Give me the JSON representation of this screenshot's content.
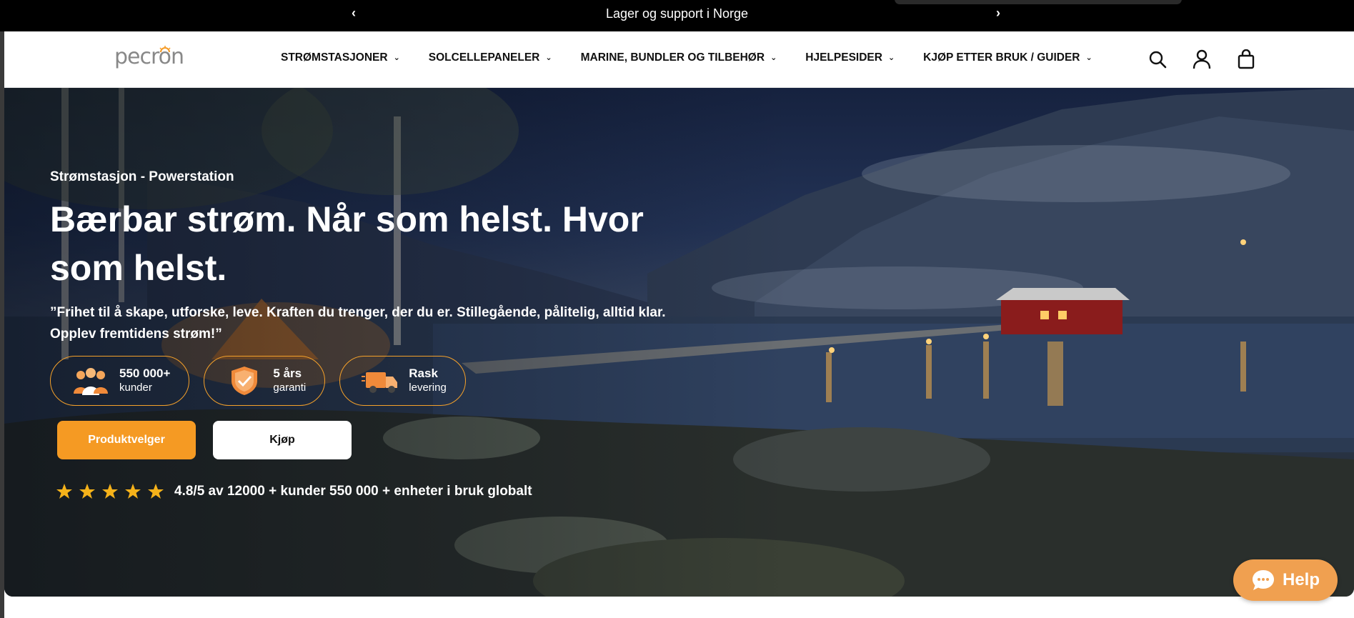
{
  "announcement": {
    "message": "Lager og support i Norge",
    "prev_icon": "chevron-left-icon",
    "next_icon": "chevron-right-icon"
  },
  "header": {
    "logo_text": "pecron",
    "nav": [
      {
        "label": "STRØMSTASJONER"
      },
      {
        "label": "SOLCELLEPANELER"
      },
      {
        "label": "MARINE, BUNDLER OG TILBEHØR"
      },
      {
        "label": "HJELPESIDER"
      },
      {
        "label": "KJØP ETTER BRUK / GUIDER"
      }
    ],
    "icons": [
      "search-icon",
      "account-icon",
      "cart-icon"
    ]
  },
  "hero": {
    "eyebrow": "Strømstasjon - Powerstation",
    "headline": "Bærbar strøm. Når som helst. Hvor som helst.",
    "subline": "”Frihet til å skape, utforske, leve. Kraften du trenger, der du er. Stillegående, pålitelig, alltid klar. Opplev fremtidens strøm!”",
    "badges": [
      {
        "line1": "550 000+",
        "line2": "kunder",
        "icon": "customers-icon"
      },
      {
        "line1": "5 års",
        "line2": "garanti",
        "icon": "warranty-shield-icon"
      },
      {
        "line1": "Rask",
        "line2": "levering",
        "icon": "delivery-truck-icon"
      }
    ],
    "buttons": {
      "primary": "Produktvelger",
      "secondary": "Kjøp"
    },
    "rating": {
      "stars": 5,
      "text": "4.8/5 av 12000 + kunder 550 000 + enheter i bruk globalt"
    }
  },
  "help_button": {
    "label": "Help",
    "icon": "chat-bubble-icon"
  },
  "colors": {
    "accent": "#f59a23",
    "announcement_bg": "#000000",
    "help_bg": "#f0a050"
  }
}
